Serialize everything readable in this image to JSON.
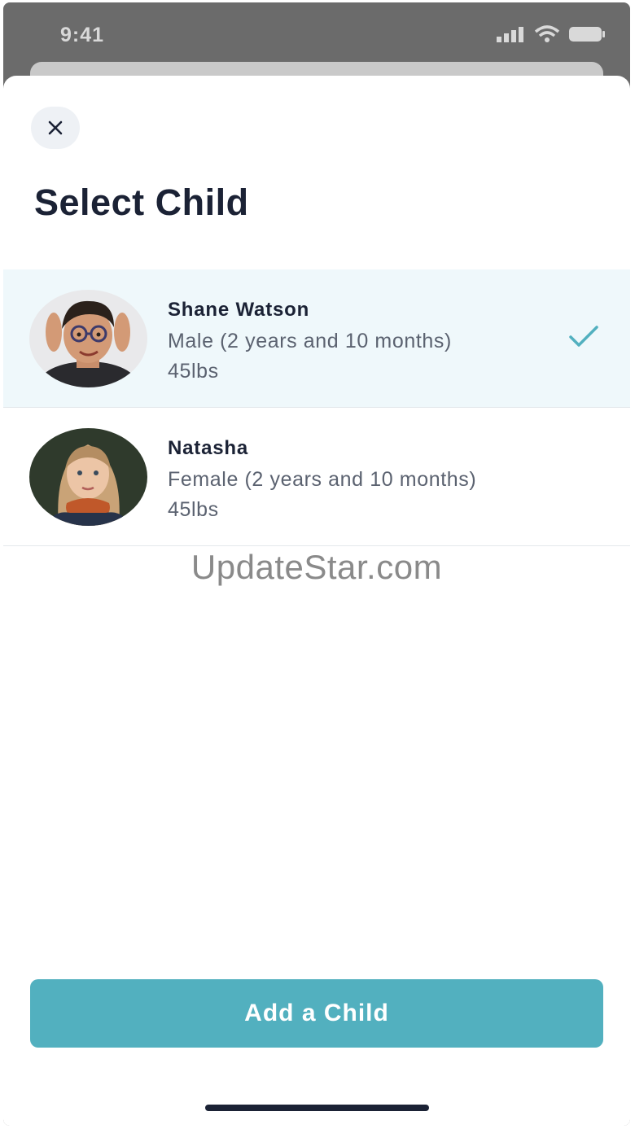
{
  "status_bar": {
    "time": "9:41"
  },
  "sheet": {
    "title": "Select Child"
  },
  "children": [
    {
      "name": "Shane Watson",
      "details": "Male (2 years and 10 months)",
      "weight": "45lbs",
      "selected": true
    },
    {
      "name": "Natasha",
      "details": "Female (2 years and 10 months)",
      "weight": "45lbs",
      "selected": false
    }
  ],
  "watermark": "UpdateStar.com",
  "add_button": {
    "label": "Add a Child"
  },
  "colors": {
    "accent": "#52b0bf",
    "selected_row": "#eff8fb",
    "title": "#1b2235",
    "check": "#52b0bf"
  }
}
